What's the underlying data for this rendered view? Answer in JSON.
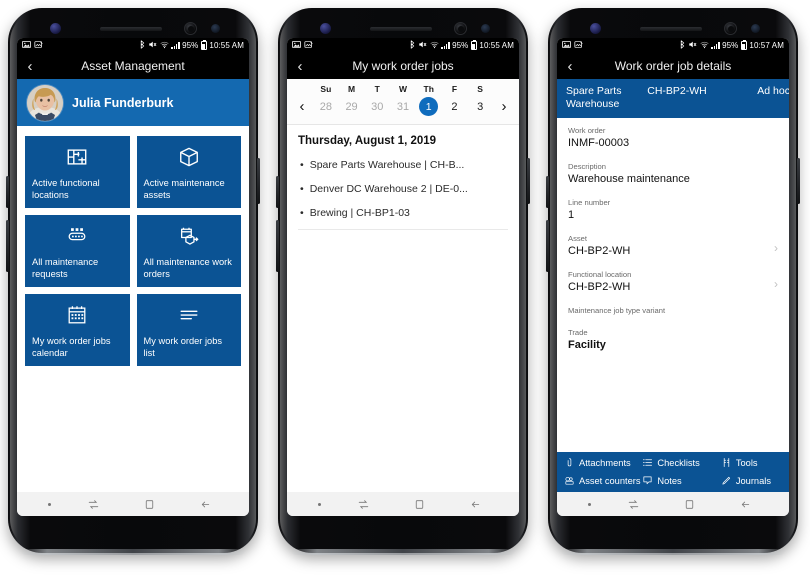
{
  "statusbar": {
    "battery": "95%",
    "time_1": "10:55 AM",
    "time_2": "10:55 AM",
    "time_3": "10:57 AM",
    "icons": [
      "image-icon",
      "screenshot-icon",
      "bluetooth-icon",
      "mute-icon",
      "wifi-icon",
      "signal-icon",
      "battery-icon"
    ]
  },
  "phone1": {
    "title": "Asset Management",
    "profile": {
      "name": "Julia Funderburk"
    },
    "tiles": [
      {
        "icon": "floorplan-icon",
        "label": "Active functional locations"
      },
      {
        "icon": "box-icon",
        "label": "Active maintenance assets"
      },
      {
        "icon": "conveyor-icon",
        "label": "All maintenance requests"
      },
      {
        "icon": "workorder-icon",
        "label": "All maintenance work orders"
      },
      {
        "icon": "calendar-icon",
        "label": "My work order jobs calendar"
      },
      {
        "icon": "list-icon",
        "label": "My work order jobs list"
      }
    ]
  },
  "phone2": {
    "title": "My work order jobs",
    "calendar": {
      "weekday_headers": [
        "Su",
        "M",
        "T",
        "W",
        "Th",
        "F",
        "S"
      ],
      "dates": [
        "28",
        "29",
        "30",
        "31",
        "1",
        "2",
        "3"
      ],
      "dimmed": [
        true,
        true,
        true,
        true,
        false,
        false,
        false
      ],
      "selected_index": 4,
      "prev_label": "‹",
      "next_label": "›",
      "accent": "#0f6cbd"
    },
    "date_header": "Thursday, August 1, 2019",
    "jobs": [
      "Spare Parts Warehouse | CH-B...",
      "Denver DC Warehouse 2 | DE-0...",
      "Brewing | CH-BP1-03"
    ]
  },
  "phone3": {
    "title": "Work order job details",
    "tabs": [
      "Spare Parts Warehouse",
      "CH-BP2-WH",
      "Ad hoc"
    ],
    "fields": [
      {
        "label": "Work order",
        "value": "INMF-00003",
        "chevron": false
      },
      {
        "label": "Description",
        "value": "Warehouse maintenance",
        "chevron": false
      },
      {
        "label": "Line number",
        "value": "1",
        "chevron": false
      },
      {
        "label": "Asset",
        "value": "CH-BP2-WH",
        "chevron": true
      },
      {
        "label": "Functional location",
        "value": "CH-BP2-WH",
        "chevron": true
      },
      {
        "label": "Maintenance job type variant",
        "value": "",
        "chevron": false
      },
      {
        "label": "Trade",
        "value": "Facility",
        "chevron": false
      }
    ],
    "actions": [
      {
        "icon": "paperclip-icon",
        "label": "Attachments"
      },
      {
        "icon": "checklist-icon",
        "label": "Checklists"
      },
      {
        "icon": "tools-icon",
        "label": "Tools"
      },
      {
        "icon": "asset-counter-icon",
        "label": "Asset counters"
      },
      {
        "icon": "note-icon",
        "label": "Notes"
      },
      {
        "icon": "pencil-icon",
        "label": "Journals"
      }
    ]
  },
  "navbar": {
    "items": [
      "dot-indicator",
      "recents-icon",
      "home-icon",
      "back-icon"
    ]
  },
  "colors": {
    "tile_blue": "#0b5394",
    "banner_blue": "#1469b0",
    "accent_blue": "#0f6cbd",
    "statusbar_black": "#000000"
  }
}
